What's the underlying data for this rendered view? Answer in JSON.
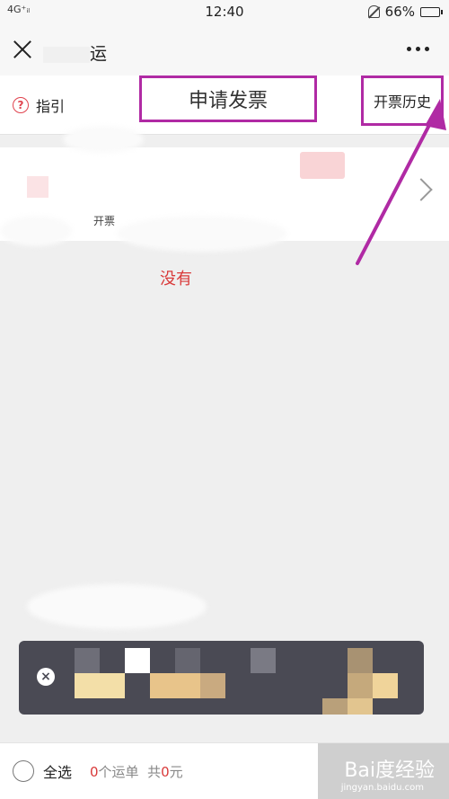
{
  "status_bar": {
    "signal": "4G⁺ᵢₗ",
    "time": "12:40",
    "battery": "66%",
    "battery_level": 0.66
  },
  "header": {
    "title": "运"
  },
  "toolbar": {
    "guide_label": "指引",
    "tab_title": "申请发票",
    "history_label": "开票历史"
  },
  "card": {
    "label": "开票"
  },
  "empty_message": "没有",
  "bottom_bar": {
    "select_all_label": "全选",
    "waybill_count": "0",
    "waybill_suffix": "个运单",
    "total_prefix": "共",
    "total_amount": "0",
    "total_suffix": "元"
  },
  "watermark": {
    "text": "Bai度经验",
    "sub": "jingyan.baidu.com"
  },
  "colors": {
    "accent_red": "#d93a3a",
    "annotation_purple": "#b02aa4",
    "toast_bg": "#4a4a54"
  }
}
